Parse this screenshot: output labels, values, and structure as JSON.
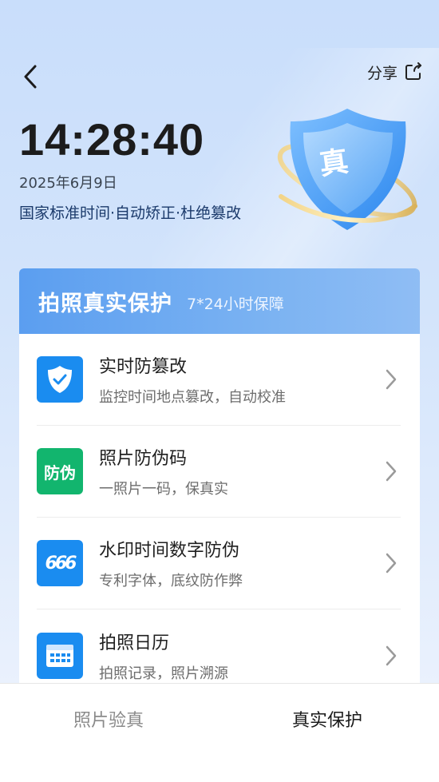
{
  "header": {
    "back_icon": "chevron-left-icon",
    "share_label": "分享",
    "share_icon": "share-icon"
  },
  "hero": {
    "time": "14:28:40",
    "date": "2025年6月9日",
    "tagline": "国家标准时间·自动矫正·杜绝篡改",
    "badge_char": "真"
  },
  "card": {
    "title": "拍照真实保护",
    "subtitle": "7*24小时保障",
    "items": [
      {
        "title": "实时防篡改",
        "desc": "监控时间地点篡改，自动校准",
        "icon": "shield-check-icon",
        "color": "#1a8cf0"
      },
      {
        "title": "照片防伪码",
        "desc": "一照片一码，保真实",
        "icon": "anti-fake-icon",
        "icon_text": "防伪",
        "color": "#12b56e"
      },
      {
        "title": "水印时间数字防伪",
        "desc": "专利字体，底纹防作弊",
        "icon": "digits-666-icon",
        "icon_text": "666",
        "color": "#1a8cf0"
      },
      {
        "title": "拍照日历",
        "desc": "拍照记录，照片溯源",
        "icon": "calendar-icon",
        "color": "#1a8cf0"
      }
    ]
  },
  "tabs": {
    "verify": "照片验真",
    "protect": "真实保护"
  }
}
